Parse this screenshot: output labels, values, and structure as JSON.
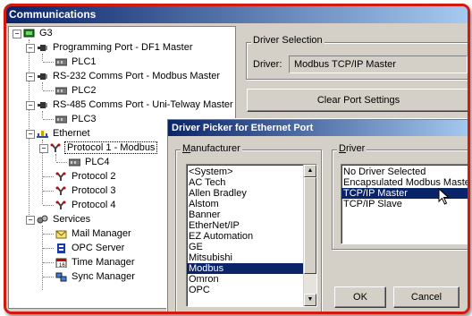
{
  "window": {
    "title": "Communications"
  },
  "tree": {
    "root": "G3",
    "prog_port": "Programming Port - DF1 Master",
    "plc1": "PLC1",
    "rs232": "RS-232 Comms Port - Modbus Master",
    "plc2": "PLC2",
    "rs485": "RS-485 Comms Port - Uni-Telway Master",
    "plc3": "PLC3",
    "ethernet": "Ethernet",
    "protocol1": "Protocol 1 - Modbus",
    "plc4": "PLC4",
    "protocol2": "Protocol 2",
    "protocol3": "Protocol 3",
    "protocol4": "Protocol 4",
    "services": "Services",
    "mail": "Mail Manager",
    "opc": "OPC Server",
    "time": "Time Manager",
    "sync": "Sync Manager"
  },
  "driver_selection": {
    "group_title": "Driver Selection",
    "driver_label": "Driver:",
    "driver_value": "Modbus TCP/IP Master",
    "clear_button": "Clear Port Settings"
  },
  "dialog": {
    "title": "Driver Picker for Ethernet Port",
    "manufacturer_title_u": "M",
    "manufacturer_title_rest": "anufacturer",
    "driver_title_u": "D",
    "driver_title_rest": "river",
    "manufacturers": [
      "<System>",
      "AC Tech",
      "Allen Bradley",
      "Alstom",
      "Banner",
      "EtherNet/IP",
      "EZ Automation",
      "GE",
      "Mitsubishi",
      "Modbus",
      "Omron",
      "OPC"
    ],
    "manufacturer_selected": "Modbus",
    "drivers": [
      "No Driver Selected",
      "Encapsulated Modbus Master",
      "TCP/IP Master",
      "TCP/IP Slave"
    ],
    "driver_selected": "TCP/IP Master",
    "ok": "OK",
    "cancel": "Cancel"
  },
  "colors": {
    "frame_border": "#d41a0e",
    "title_blue": "#0a246a",
    "selection": "#0a246a",
    "face": "#d4d0c8"
  }
}
